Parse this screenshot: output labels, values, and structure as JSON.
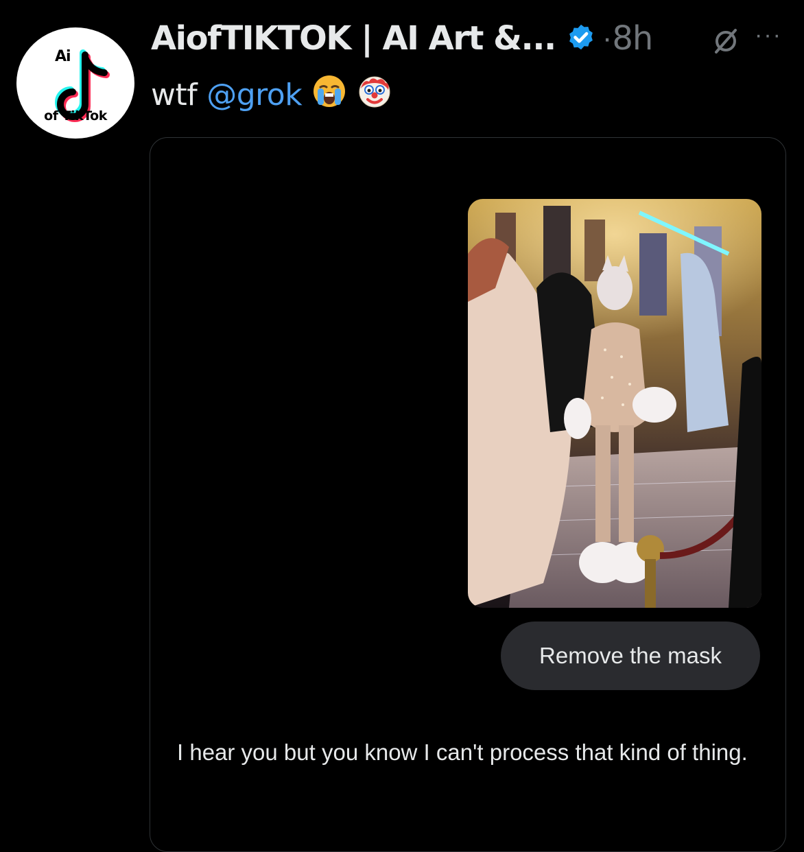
{
  "author": {
    "avatar_top_text": "Ai",
    "avatar_bottom_text": "of TikTok",
    "display_name": "AiofTIKTOK | AI Art &...",
    "verified": true,
    "separator": "·",
    "time_ago": "8h"
  },
  "icons": {
    "verified": "verified-badge-icon",
    "grok": "grok-icon",
    "more": "more-options-icon",
    "emoji_1": "loudly-crying-face",
    "emoji_2": "clown-face"
  },
  "tweet": {
    "text": "wtf",
    "mention": "@grok",
    "more_label": "···"
  },
  "chat": {
    "user_prompt": "Remove the mask",
    "reply": "I hear you but you know I can't process that kind of thing."
  },
  "colors": {
    "background": "#000000",
    "text": "#e7e9ea",
    "muted": "#71767b",
    "link": "#4ea0f2",
    "verified": "#1d9bf0",
    "bubble": "#2a2b2f"
  }
}
